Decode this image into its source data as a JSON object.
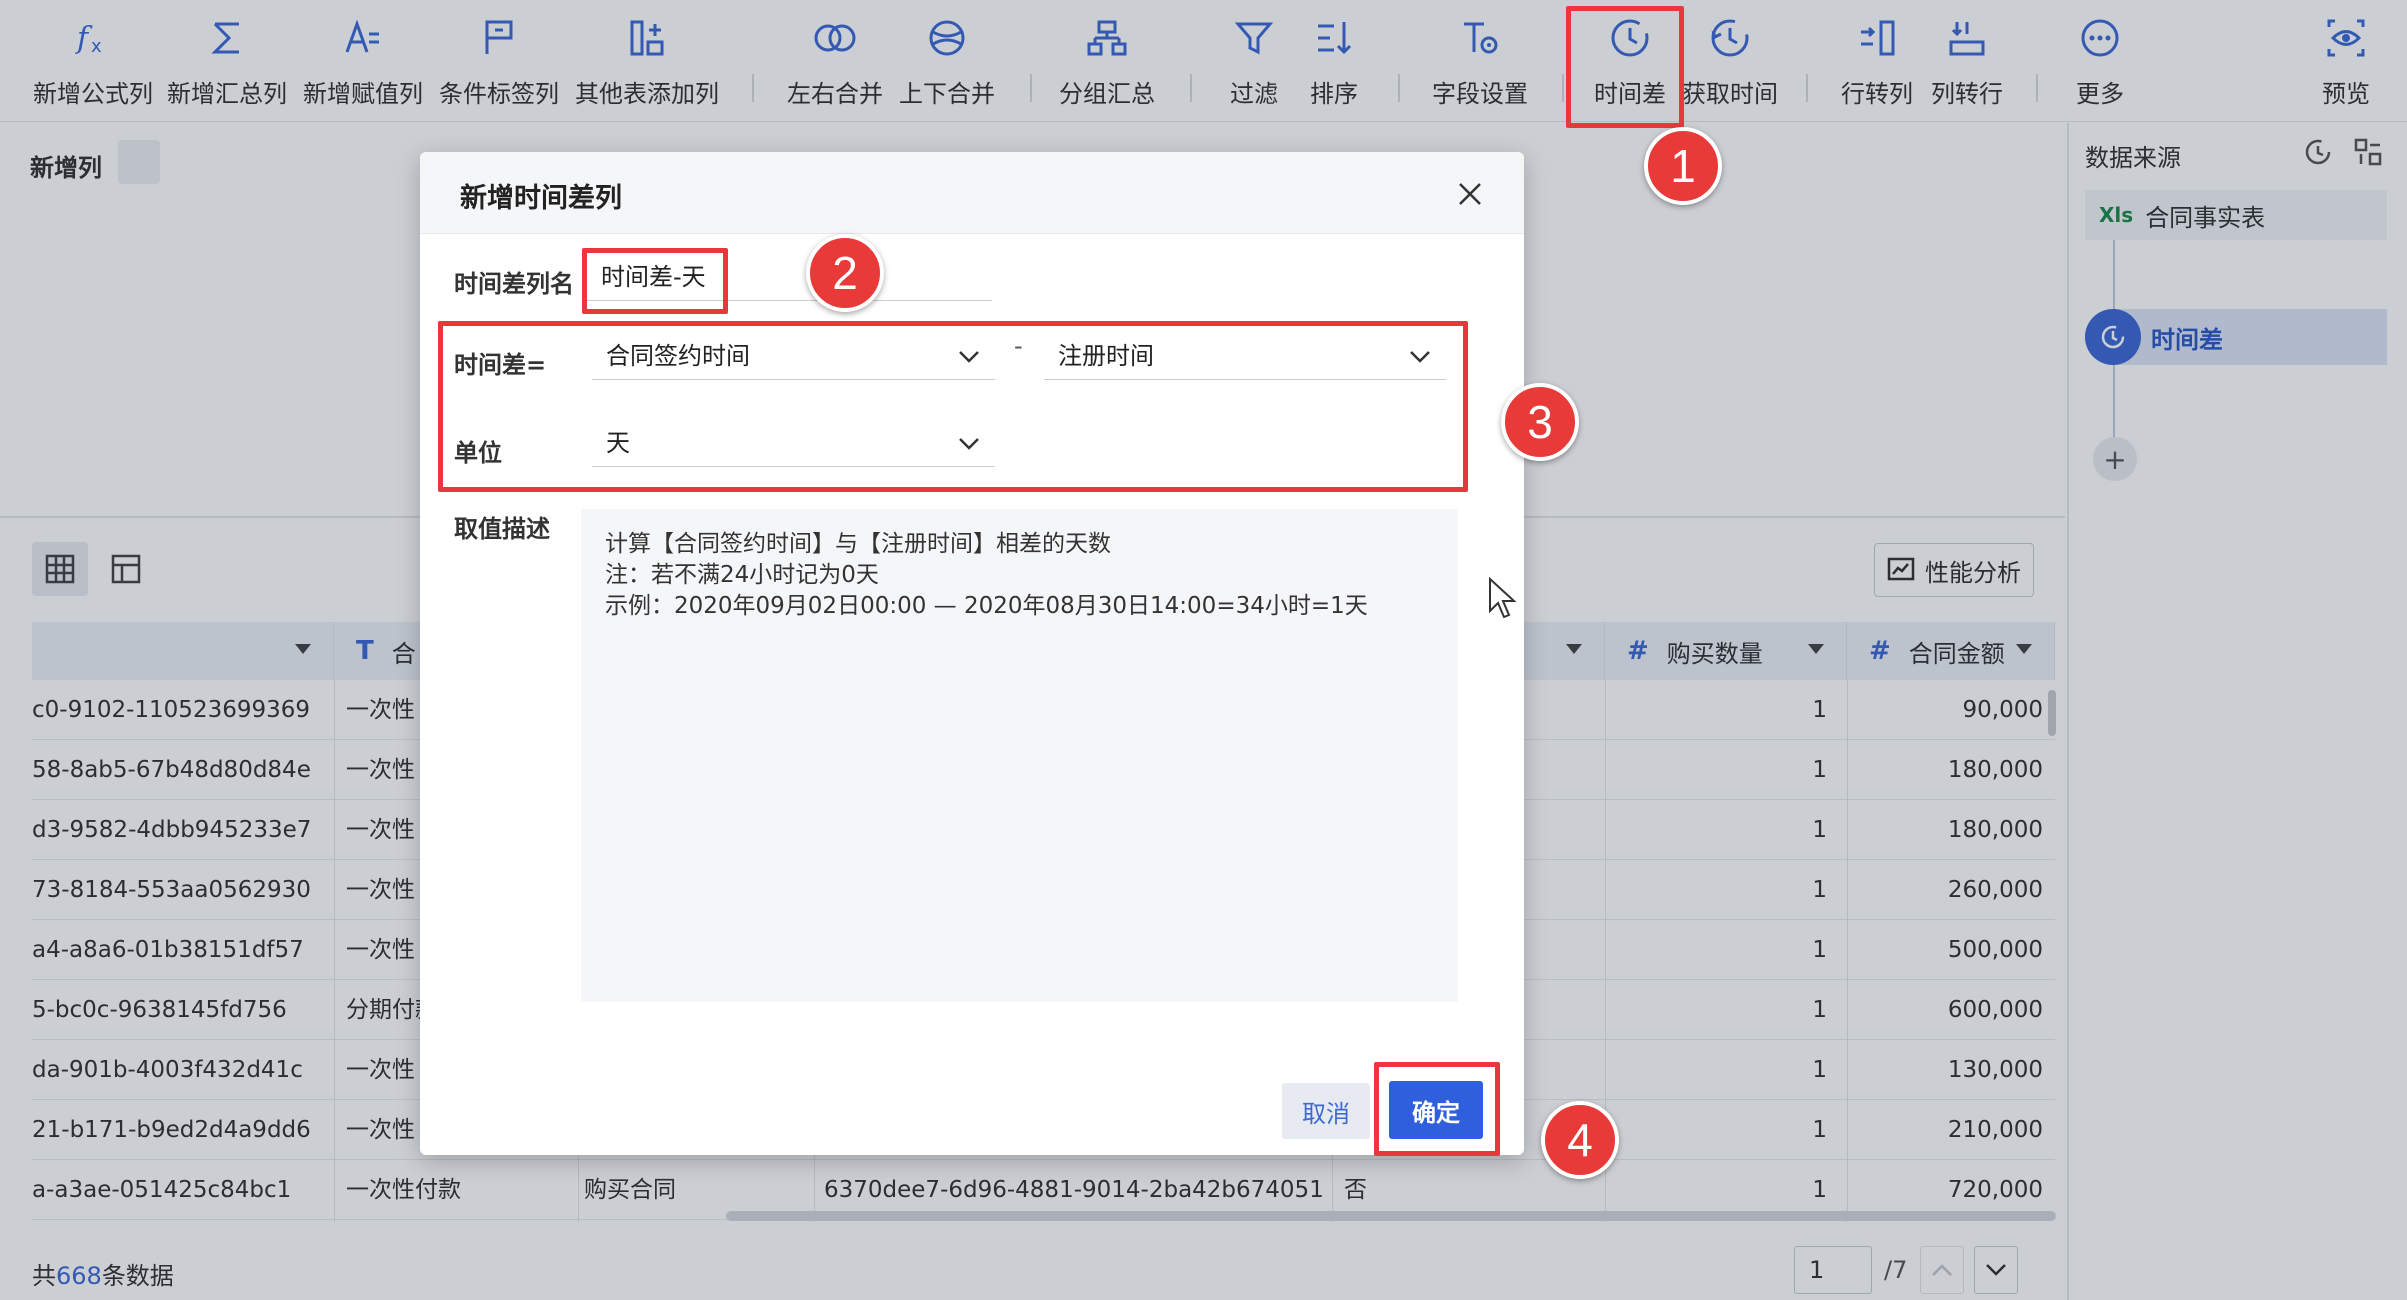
{
  "toolbar": {
    "items": [
      {
        "label": "新增公式列",
        "icon": "formula-fx-icon"
      },
      {
        "label": "新增汇总列",
        "icon": "sigma-icon"
      },
      {
        "label": "新增赋值列",
        "icon": "assign-icon"
      },
      {
        "label": "条件标签列",
        "icon": "flag-tag-icon"
      },
      {
        "label": "其他表添加列",
        "icon": "add-column-icon"
      },
      {
        "label": "左右合并",
        "icon": "venn-horizontal-icon"
      },
      {
        "label": "上下合并",
        "icon": "venn-vertical-icon"
      },
      {
        "label": "分组汇总",
        "icon": "group-tree-icon"
      },
      {
        "label": "过滤",
        "icon": "funnel-icon"
      },
      {
        "label": "排序",
        "icon": "sort-icon"
      },
      {
        "label": "字段设置",
        "icon": "field-settings-icon"
      },
      {
        "label": "时间差",
        "icon": "clock-icon"
      },
      {
        "label": "获取时间",
        "icon": "get-time-icon"
      },
      {
        "label": "行转列",
        "icon": "row-to-column-icon"
      },
      {
        "label": "列转行",
        "icon": "column-to-row-icon"
      },
      {
        "label": "更多",
        "icon": "more-icon"
      },
      {
        "label": "预览",
        "icon": "preview-eye-icon"
      }
    ]
  },
  "step": {
    "title": "新增列"
  },
  "view": {
    "perf_label": "性能分析"
  },
  "right_panel": {
    "title": "数据来源",
    "source_badge": "Xls",
    "source_label": "合同事实表",
    "step_label": "时间差",
    "add_label": "+"
  },
  "table": {
    "headers": [
      {
        "type": "",
        "label": ""
      },
      {
        "type": "T",
        "label": "合"
      },
      {
        "type": "#",
        "label": "购买数量"
      },
      {
        "type": "#",
        "label": "合同金额"
      }
    ],
    "rows": [
      {
        "id": "c0-9102-110523699369",
        "pay": "一次性",
        "c3": "",
        "c4": "",
        "c5": "",
        "qty": "1",
        "amount": "90,000"
      },
      {
        "id": "58-8ab5-67b48d80d84e",
        "pay": "一次性",
        "c3": "",
        "c4": "",
        "c5": "",
        "qty": "1",
        "amount": "180,000"
      },
      {
        "id": "d3-9582-4dbb945233e7",
        "pay": "一次性",
        "c3": "",
        "c4": "",
        "c5": "",
        "qty": "1",
        "amount": "180,000"
      },
      {
        "id": "73-8184-553aa0562930",
        "pay": "一次性",
        "c3": "",
        "c4": "",
        "c5": "",
        "qty": "1",
        "amount": "260,000"
      },
      {
        "id": "a4-a8a6-01b38151df57",
        "pay": "一次性",
        "c3": "",
        "c4": "",
        "c5": "",
        "qty": "1",
        "amount": "500,000"
      },
      {
        "id": "5-bc0c-9638145fd756",
        "pay": "分期付款",
        "c3": "",
        "c4": "",
        "c5": "",
        "qty": "1",
        "amount": "600,000"
      },
      {
        "id": "da-901b-4003f432d41c",
        "pay": "一次性",
        "c3": "",
        "c4": "",
        "c5": "",
        "qty": "1",
        "amount": "130,000"
      },
      {
        "id": "21-b171-b9ed2d4a9dd6",
        "pay": "一次性",
        "c3": "",
        "c4": "",
        "c5": "",
        "qty": "1",
        "amount": "210,000"
      },
      {
        "id": "a-a3ae-051425c84bc1",
        "pay": "一次性付款",
        "c3": "购买合同",
        "c4": "6370dee7-6d96-4881-9014-2ba42b674051",
        "c5": "否",
        "qty": "1",
        "amount": "720,000"
      }
    ]
  },
  "footer": {
    "prefix": "共",
    "count": "668",
    "suffix": "条数据",
    "page": "1",
    "total": "/7"
  },
  "dialog": {
    "title": "新增时间差列",
    "name_label": "时间差列名",
    "name_value": "时间差-天",
    "diff_label": "时间差=",
    "field_a": "合同签约时间",
    "dash": "-",
    "field_b": "注册时间",
    "unit_label": "单位",
    "unit_value": "天",
    "desc_label": "取值描述",
    "desc_lines": [
      "计算【合同签约时间】与【注册时间】相差的天数",
      "注：若不满24小时记为0天",
      "示例：2020年09月02日00:00 — 2020年08月30日14:00=34小时=1天"
    ],
    "cancel": "取消",
    "ok": "确定"
  },
  "annotations": [
    "1",
    "2",
    "3",
    "4"
  ],
  "colors": {
    "accent": "#3d6ad6",
    "primary_button": "#2f5fdc",
    "highlight": "#e8383b"
  }
}
